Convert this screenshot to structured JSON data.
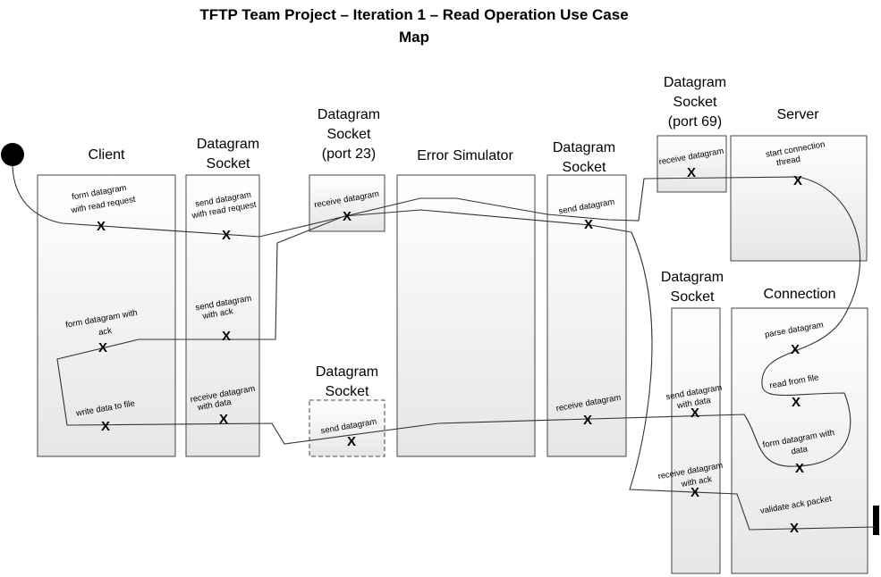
{
  "title": {
    "line1": "TFTP Team Project – Iteration 1 – Read Operation Use Case",
    "line2": "Map"
  },
  "components": {
    "client": "Client",
    "client_socket": [
      "Datagram",
      "Socket"
    ],
    "ds23": [
      "Datagram",
      "Socket",
      "(port 23)"
    ],
    "ds_bottom": [
      "Datagram",
      "Socket"
    ],
    "error_simulator": "Error Simulator",
    "es_socket": [
      "Datagram",
      "Socket"
    ],
    "ds69": [
      "Datagram",
      "Socket",
      "(port 69)"
    ],
    "server": "Server",
    "conn_socket": [
      "Datagram",
      "Socket"
    ],
    "connection": "Connection"
  },
  "responsibilities": {
    "form_read_request": [
      "form datagram",
      "with read request"
    ],
    "send_read_request": [
      "send datagram",
      "with read request"
    ],
    "receive_23": [
      "receive datagram"
    ],
    "send_es": [
      "send datagram"
    ],
    "receive_69": [
      "receive datagram"
    ],
    "start_thread": [
      "start connection",
      "thread"
    ],
    "form_ack": [
      "form datagram with",
      "ack"
    ],
    "send_ack": [
      "send datagram",
      "with ack"
    ],
    "parse": [
      "parse datagram"
    ],
    "read_file": [
      "read from file"
    ],
    "form_data": [
      "form datagram with",
      "data"
    ],
    "send_data": [
      "send datagram",
      "with data"
    ],
    "receive_es": [
      "receive datagram"
    ],
    "send_bottom": [
      "send datagram"
    ],
    "receive_data": [
      "receive datagram",
      "with data"
    ],
    "write_file": [
      "write data to file"
    ],
    "receive_ack": [
      "receive datagram",
      "with ack"
    ],
    "validate_ack": [
      "validate ack packet"
    ]
  },
  "marker": "X",
  "colors": {
    "box_fill_top": "#ffffff",
    "box_fill_bottom": "#e6e6e6",
    "line": "#333333",
    "start": "#000000"
  }
}
